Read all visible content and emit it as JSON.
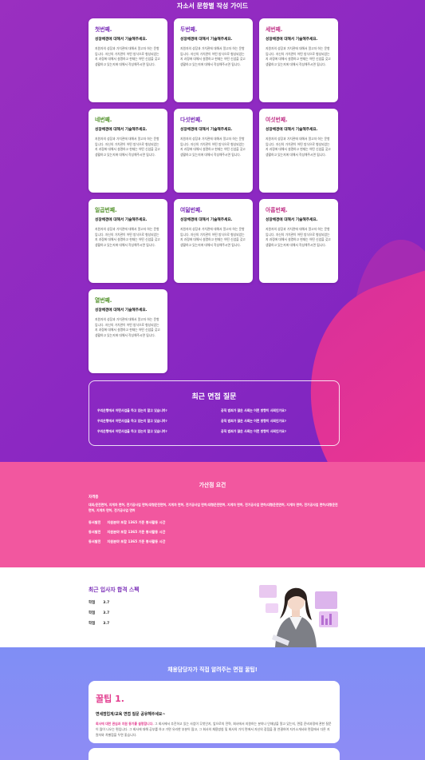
{
  "guide": {
    "title": "자소서 문항별 작성 가이드",
    "cards": [
      {
        "title": "첫번째.",
        "color": "#7b2fb8"
      },
      {
        "title": "두번째.",
        "color": "#7b2fb8"
      },
      {
        "title": "세번째.",
        "color": "#c2388a"
      },
      {
        "title": "네번째.",
        "color": "#55932e"
      },
      {
        "title": "다섯번째.",
        "color": "#7b2fb8"
      },
      {
        "title": "여섯번째.",
        "color": "#c2388a"
      },
      {
        "title": "일곱번째.",
        "color": "#55932e"
      },
      {
        "title": "여덟번째.",
        "color": "#7b2fb8"
      },
      {
        "title": "아홉번째.",
        "color": "#c2388a"
      },
      {
        "title": "열번째.",
        "color": "#55932e"
      }
    ],
    "card_subtitle": "성장배경에 대해서 기술해주세요.",
    "card_body": "지원자의 성장과 가치관에 대해서 알고자 하는 문항입니다. 자신의 가치관이 어떤 방식으로 형성되었는지 과정에 대해서 설명하고 현재는 어떤 신념을 갖고 생활하고 있는지에 대해서 작성해주시면 됩니다."
  },
  "interview": {
    "title": "최근 면접 질문",
    "left_question": "우리은행에서 어떤사업을 하고 있는지 알고 있습니까?",
    "right_question": "공직 범죄가 많은 사회는 어떤 방향이 사회인가요?"
  },
  "perks": {
    "title": "가산점 요건",
    "heading": "자격증",
    "list": "대외/운전면허, 지게차 면허, 전기공사업 면허/대형운전면허, 지게차 면허, 전기공사업 면허/대형운전면허, 지게차 면허, 전기공사업 면허/대형운전면허, 지게차 면허, 전기공사업 면허/대형운전면허, 지게차 면허, 전기공사업 면허",
    "rows": [
      {
        "tag": "동서발전",
        "text": "지원분야 포함 1365 기준 봉사활동 시간"
      },
      {
        "tag": "동서발전",
        "text": "지원분야 포함 1365 기준 봉사활동 시간"
      },
      {
        "tag": "동서발전",
        "text": "지원분야 포함 1365 기준 봉사활동 시간"
      }
    ]
  },
  "specs": {
    "title": "최근 입사자 합격 스펙",
    "items": [
      {
        "label": "학점",
        "value": "3.7"
      },
      {
        "label": "학점",
        "value": "3.7"
      },
      {
        "label": "학점",
        "value": "3.7"
      }
    ]
  },
  "tips": {
    "title": "채용담당자가 직접 알려주는 면접 꿀팁!",
    "tip1_title": "꿀팁 1.",
    "tip1_subtitle": "면세점업계/교육 면접 질문 공유해주세요~",
    "tip1_highlight": "회사에 대한 관심과 지원 동기를 설명합니다.",
    "tip1_body": "그 회사에서 추진하고 있는 사업이 무엇인지, 앞으로의 전략, 회사에서 지원하는 분야나 인재상을 알고 있는지, 면접 준비과정에 관한 질문이 많이 나오는 편입니다. 그 회사에 대해 공부를 하고 가면 유리한 부분이 많고, 그 회사의 채용방침 및 회사의 가치 면에서 자신의 장점을 잘 연결하여 자기소개서와 면접에서 다른 지원자와 차별점을 두면 좋습니다."
  }
}
